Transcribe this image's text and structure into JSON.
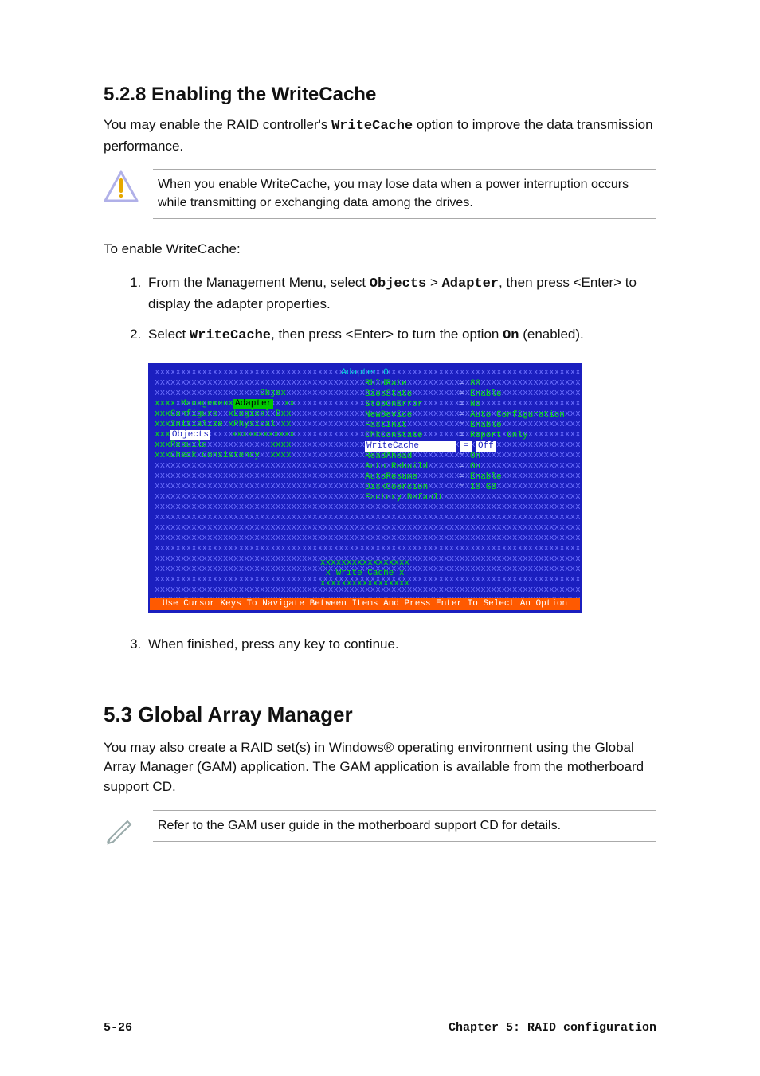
{
  "section_528": {
    "heading": "5.2.8   Enabling the WriteCache",
    "intro_pre": "You may enable the RAID controller's ",
    "intro_mono": "WriteCache",
    "intro_post": " option to improve the data transmission performance.",
    "warning": "When you enable WriteCache, you may lose data when a power interruption occurs while transmitting or exchanging data among the drives.",
    "lead": "To enable WriteCache:",
    "step1_a": "From the Management Menu, select ",
    "step1_m1": "Objects",
    "step1_b": " > ",
    "step1_m2": "Adapter",
    "step1_c": ", then press <Enter> to display the adapter properties.",
    "step2_a": "Select ",
    "step2_m1": "WriteCache",
    "step2_b": ", then press <Enter> to turn the option ",
    "step2_m2": "On",
    "step2_c": " (enabled).",
    "step3": "When finished, press any key to continue."
  },
  "bios": {
    "title": "Adapter 0",
    "left_menu": {
      "obje": "Obje",
      "management": "Managemen",
      "adapter_hl": "Adapter",
      "configure": "Configure",
      "logical": "Logical D",
      "initialize": "Initialize",
      "physical": "Physical",
      "objects_hl": "Objects",
      "rebuild": "Rebuild",
      "check": "Check Consistency"
    },
    "props": [
      {
        "k": "RbldRate",
        "v": "80"
      },
      {
        "k": "BiosState",
        "v": "Enable"
      },
      {
        "k": "StopOnError",
        "v": "No"
      },
      {
        "k": "NewDevice",
        "v": "Auto Configuration"
      },
      {
        "k": "FastInit",
        "v": "Enable"
      },
      {
        "k": "ChkConState",
        "v": "Report Only"
      },
      {
        "k": "WriteCache",
        "v": "Off",
        "hl": true
      },
      {
        "k": "ReadAhead",
        "v": "On"
      },
      {
        "k": "Auto Rebuild",
        "v": "On"
      },
      {
        "k": "AutoResume",
        "v": "Enable"
      },
      {
        "k": "DiskCoercion",
        "v": "10 GB"
      },
      {
        "k": "Factory Default",
        "v": ""
      }
    ],
    "popup_label": "Write Cache",
    "helpbar": "Use Cursor Keys To Navigate Between Items And Press Enter To Select An Option"
  },
  "section_53": {
    "heading": "5.3    Global Array Manager",
    "body": "You may also create a RAID set(s) in Windows® operating environment using the Global Array Manager (GAM) application. The GAM application is available from the motherboard support CD.",
    "note": "Refer to the GAM user guide in the motherboard support CD for details."
  },
  "footer": {
    "page": "5-26",
    "chapter": "Chapter 5: RAID configuration"
  }
}
